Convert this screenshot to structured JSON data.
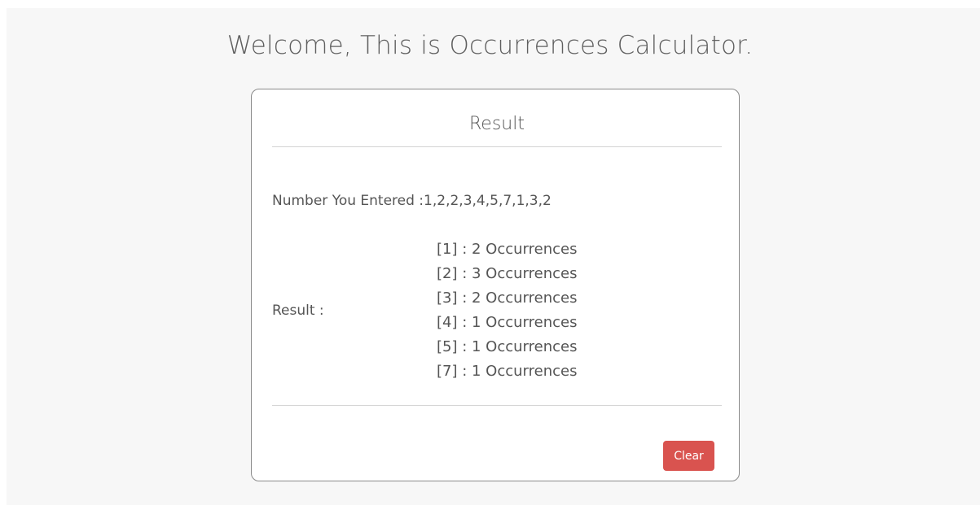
{
  "page": {
    "title": "Welcome, This is Occurrences Calculator."
  },
  "card": {
    "header": "Result",
    "entered_label": "Number You Entered :",
    "entered_value": "1,2,2,3,4,5,7,1,3,2",
    "result_label": "Result :",
    "results": [
      "[1] : 2 Occurrences",
      "[2] : 3 Occurrences",
      "[3] : 2 Occurrences",
      "[4] : 1 Occurrences",
      "[5] : 1 Occurrences",
      "[7] : 1 Occurrences"
    ],
    "clear_label": "Clear"
  },
  "colors": {
    "background": "#f7f7f7",
    "clear_button": "#d9534f"
  }
}
